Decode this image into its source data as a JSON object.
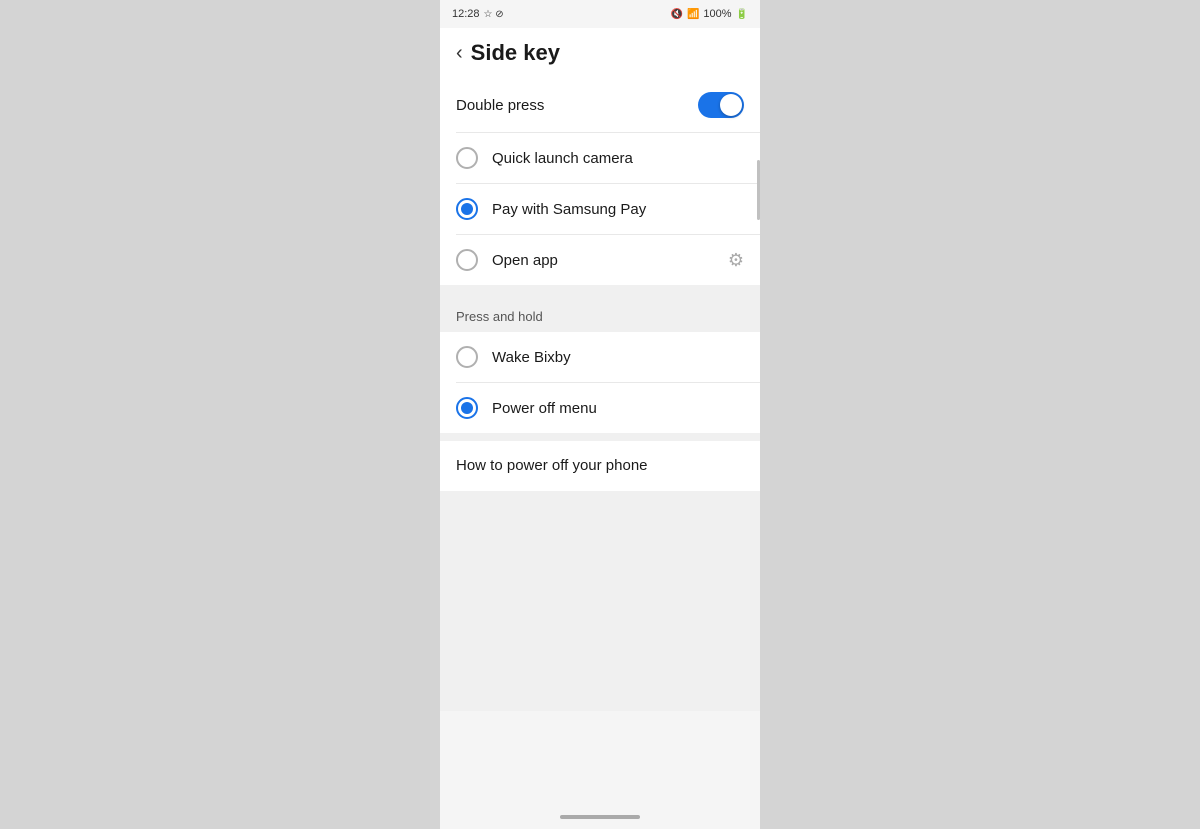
{
  "statusBar": {
    "time": "12:28",
    "battery": "100%",
    "icons": "🔇 📶 🔋"
  },
  "header": {
    "backLabel": "‹",
    "title": "Side key"
  },
  "doublePress": {
    "sectionLabel": "Double press",
    "toggleEnabled": true,
    "options": [
      {
        "id": "quick-launch-camera",
        "label": "Quick launch camera",
        "selected": false
      },
      {
        "id": "pay-samsung-pay",
        "label": "Pay with Samsung Pay",
        "selected": true
      },
      {
        "id": "open-app",
        "label": "Open app",
        "selected": false,
        "hasGear": true
      }
    ]
  },
  "pressAndHold": {
    "sectionLabel": "Press and hold",
    "options": [
      {
        "id": "wake-bixby",
        "label": "Wake Bixby",
        "selected": false
      },
      {
        "id": "power-off-menu",
        "label": "Power off menu",
        "selected": true
      }
    ]
  },
  "howToPowerOff": {
    "label": "How to power off your phone"
  },
  "icons": {
    "back": "❮",
    "gear": "⚙",
    "mute": "🔇",
    "wifi": "▲",
    "battery": "▮"
  }
}
